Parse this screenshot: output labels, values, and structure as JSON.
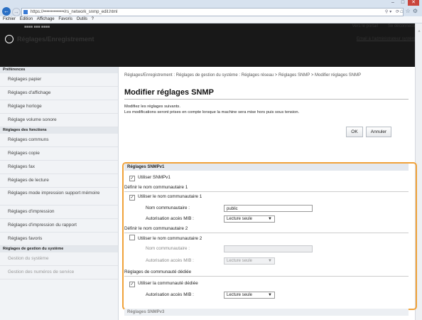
{
  "browser": {
    "url": "https://••••••••••••••/rs_network_snmp_edit.html",
    "menu": [
      "Fichier",
      "Edition",
      "Affichage",
      "Favoris",
      "Outils",
      "?"
    ]
  },
  "header": {
    "portal_link": "Vers le portail",
    "logout_link": "Se déconnecter",
    "title": "Réglages/Enregistrement",
    "admin_link": "Email à l'administrateur système"
  },
  "sidebar": {
    "section_prefs": "Préférences",
    "prefs_items": [
      "Réglages papier",
      "Réglages d'affichage",
      "Réglage horloge",
      "Réglage volume sonore"
    ],
    "section_functions": "Réglages des fonctions",
    "function_items": [
      "Réglages communs",
      "Réglages copie",
      "Réglages fax",
      "Réglages de lecture"
    ],
    "media_item": "Réglages mode impression support mémoire",
    "print_items": [
      "Réglages d'impression",
      "Réglages d'impression du rapport",
      "Réglages favoris"
    ],
    "section_system": "Réglages de gestion du système",
    "system_items": [
      "Gestion du système",
      "Gestion des numéros de service"
    ]
  },
  "content": {
    "breadcrumb": "Réglages/Enregistrement : Réglages de gestion du système : Réglages réseau > Réglages SNMP > Modifier réglages SNMP",
    "title": "Modifier réglages SNMP",
    "desc1": "Modifiez les réglages suivants.",
    "desc2": "Les modifications seront prises en compte lorsque la machine sera mise hors puis sous tension.",
    "ok": "OK",
    "cancel": "Annuler"
  },
  "snmpv1": {
    "heading": "Réglages SNMPv1",
    "use_label": "Utiliser SNMPv1",
    "use_checked": true,
    "community1": {
      "heading": "Définir le nom communautaire 1",
      "use_label": "Utiliser le nom communautaire 1",
      "checked": true,
      "name_label": "Nom communautaire :",
      "name_value": "public",
      "mib_label": "Autorisation accès MIB :",
      "mib_value": "Lecture seule"
    },
    "community2": {
      "heading": "Définir le nom communautaire 2",
      "use_label": "Utiliser le nom communautaire 2",
      "checked": false,
      "name_label": "Nom communautaire :",
      "name_value": "",
      "mib_label": "Autorisation accès MIB :",
      "mib_value": "Lecture seule"
    },
    "dedicated": {
      "heading": "Réglages de communauté dédiée",
      "use_label": "Utiliser la communauté dédiée",
      "checked": true,
      "mib_label": "Autorisation accès MIB :",
      "mib_value": "Lecture seule"
    }
  },
  "snmpv3": {
    "heading": "Réglages SNMPv3"
  },
  "colors": {
    "highlight": "#f0a23a",
    "header_bg": "#181818"
  }
}
